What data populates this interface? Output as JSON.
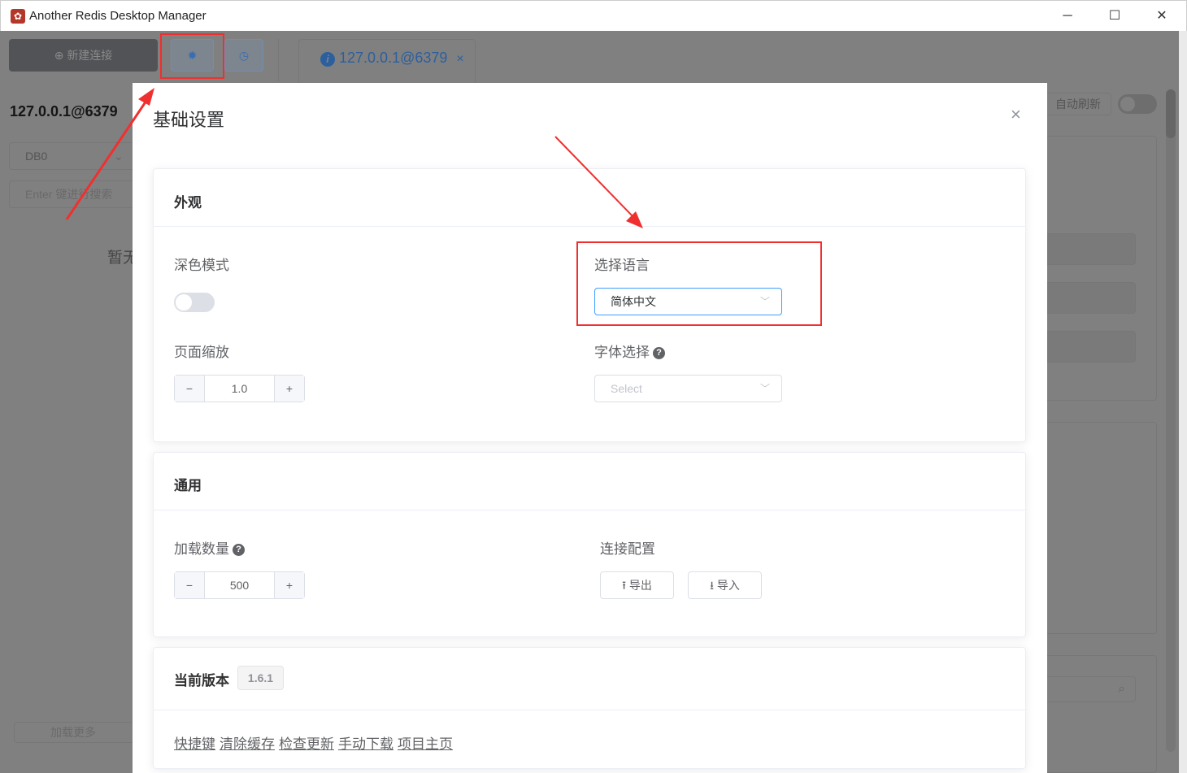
{
  "window": {
    "title": "Another Redis Desktop Manager",
    "minimize": "─",
    "maximize": "☐",
    "close": "✕"
  },
  "toolbar": {
    "new_connection": "新建连接",
    "settings_icon": "gear-icon",
    "history_icon": "clock-icon"
  },
  "tab": {
    "label": "127.0.0.1@6379",
    "close": "×"
  },
  "sidebar": {
    "connection": "127.0.0.1@6379",
    "db": "DB0",
    "search_placeholder": "Enter 键进行搜索",
    "empty": "暂无",
    "load_more": "加载更多"
  },
  "right_panel": {
    "auto_refresh": "自动刷新"
  },
  "dialog": {
    "title": "基础设置",
    "close": "×",
    "appearance": {
      "header": "外观",
      "dark_mode": "深色模式",
      "dark_mode_on": false,
      "language_label": "选择语言",
      "language_value": "简体中文",
      "zoom_label": "页面缩放",
      "zoom_value": "1.0",
      "font_label": "字体选择",
      "font_placeholder": "Select"
    },
    "general": {
      "header": "通用",
      "load_count_label": "加载数量",
      "load_count_value": "500",
      "connection_config": "连接配置",
      "export": "导出",
      "import": "导入"
    },
    "version": {
      "header": "当前版本",
      "value": "1.6.1",
      "links": [
        "快捷键",
        "清除缓存",
        "检查更新",
        "手动下载",
        "项目主页"
      ]
    }
  },
  "colors": {
    "accent": "#409eff",
    "annotation": "#f03030"
  }
}
